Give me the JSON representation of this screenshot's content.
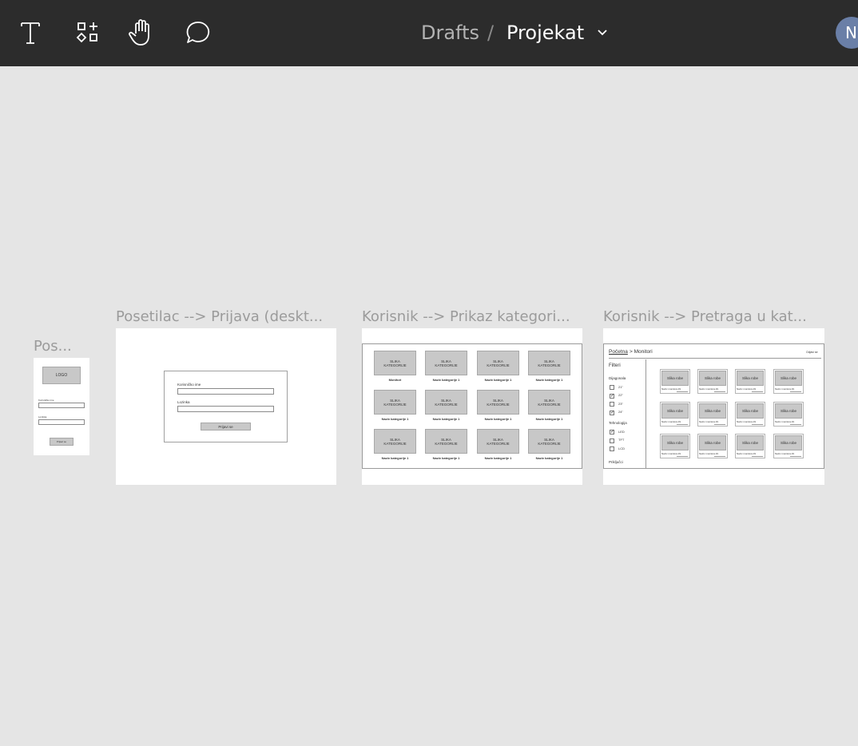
{
  "toolbar": {
    "tools": [
      {
        "name": "text-tool",
        "icon": "text-icon"
      },
      {
        "name": "components-tool",
        "icon": "components-icon"
      },
      {
        "name": "hand-tool",
        "icon": "hand-icon"
      },
      {
        "name": "comment-tool",
        "icon": "comment-icon"
      }
    ],
    "breadcrumb_drafts": "Drafts",
    "breadcrumb_separator": "/",
    "project_name": "Projekat",
    "avatar_initial": "N"
  },
  "frames": {
    "mobile": {
      "title": "Pos...",
      "logo": "LOGO",
      "username_label": "Korisničko ime",
      "password_label": "Lozinka",
      "button": "Prijavi se"
    },
    "login": {
      "title": "Posetilac --> Prijava (deskt...",
      "username_label": "Korisničko ime",
      "password_label": "Lozinka",
      "button": "Prijavi se"
    },
    "categories": {
      "title": "Korisnik --> Prikaz kategori...",
      "cards": [
        {
          "image": "SLIKA KATEGORIJE",
          "label": "Monitori"
        },
        {
          "image": "SLIKA KATEGORIJE",
          "label": "Naziv kategorije 1"
        },
        {
          "image": "SLIKA KATEGORIJE",
          "label": "Naziv kategorije 1"
        },
        {
          "image": "SLIKA KATEGORIJE",
          "label": "Naziv kategorije 1"
        },
        {
          "image": "SLIKA KATEGORIJE",
          "label": "Naziv kategorije 1"
        },
        {
          "image": "SLIKA KATEGORIJE",
          "label": "Naziv kategorije 1"
        },
        {
          "image": "SLIKA KATEGORIJE",
          "label": "Naziv kategorije 1"
        },
        {
          "image": "SLIKA KATEGORIJE",
          "label": "Naziv kategorije 1"
        },
        {
          "image": "SLIKA KATEGORIJE",
          "label": "Naziv kategorije 1"
        },
        {
          "image": "SLIKA KATEGORIJE",
          "label": "Naziv kategorije 1"
        },
        {
          "image": "SLIKA KATEGORIJE",
          "label": "Naziv kategorije 1"
        },
        {
          "image": "SLIKA KATEGORIJE",
          "label": "Naziv kategorije 1"
        }
      ]
    },
    "search": {
      "title": "Korisnik --> Pretraga u kat...",
      "breadcrumb_home": "Početna",
      "breadcrumb_rest": " > Monitori",
      "logout": "Odjavi se",
      "filters_title": "Filteri",
      "diagonal_label": "Dijagonala",
      "diagonal_options": [
        {
          "label": "21\"",
          "checked": false
        },
        {
          "label": "22\"",
          "checked": true
        },
        {
          "label": "23\"",
          "checked": false
        },
        {
          "label": "24\"",
          "checked": true
        }
      ],
      "tech_label": "Tehnologija",
      "tech_options": [
        {
          "label": "LED",
          "checked": true
        },
        {
          "label": "TFT",
          "checked": false
        },
        {
          "label": "LCD",
          "checked": false
        }
      ],
      "connectors_label": "Priključci",
      "product_image": "Slika robe",
      "product_name": "Naziv monitora #1"
    }
  }
}
